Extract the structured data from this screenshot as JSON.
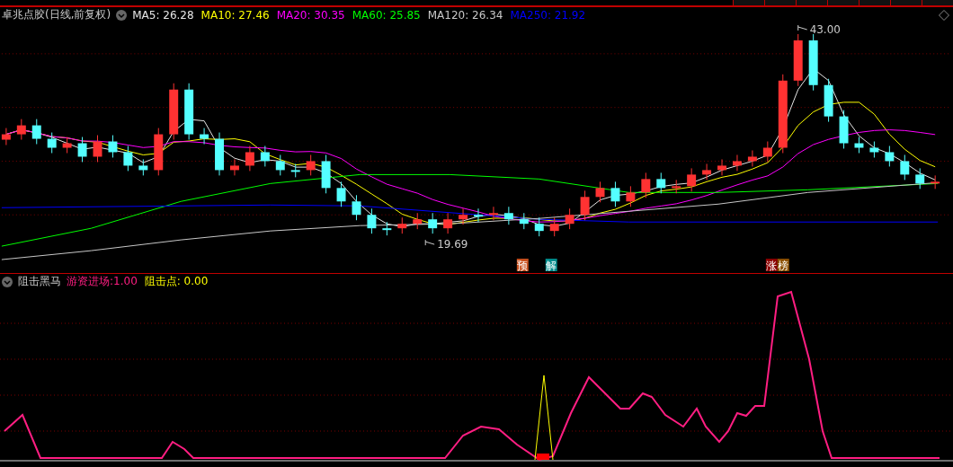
{
  "main_legend": {
    "title": "卓兆点胶(日线,前复权)",
    "items": [
      {
        "text": "MA5: 26.28",
        "color": "#e6e6e6"
      },
      {
        "text": "MA10: 27.46",
        "color": "#ffff00"
      },
      {
        "text": "MA20: 30.35",
        "color": "#ff00ff"
      },
      {
        "text": "MA60: 25.85",
        "color": "#00ff00"
      },
      {
        "text": "MA120: 26.34",
        "color": "#c8c8c8"
      },
      {
        "text": "MA250: 21.92",
        "color": "#0000ff"
      }
    ]
  },
  "price_labels": [
    {
      "kind": "high",
      "text": "43.00"
    },
    {
      "kind": "low",
      "text": "19.69"
    }
  ],
  "signal_badges": [
    {
      "text": "预",
      "color": "#c8501e"
    },
    {
      "text": "解",
      "color": "#008c8c"
    },
    {
      "text": "涨",
      "color": "#8c0000"
    },
    {
      "text": "榜",
      "color": "#8c5000"
    }
  ],
  "indicator_legend": {
    "title": "阻击黑马",
    "items": [
      {
        "text": "游资进场:1.00",
        "color": "#ff1e82"
      },
      {
        "text": "阻击点: 0.00",
        "color": "#ffff00"
      }
    ]
  }
}
